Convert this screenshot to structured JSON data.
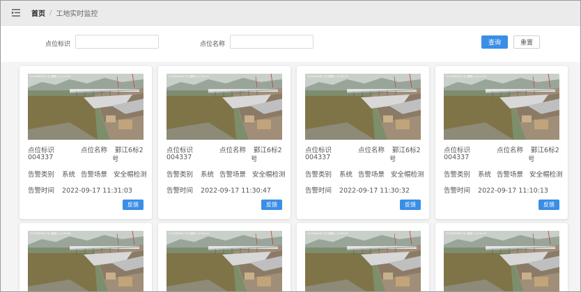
{
  "header": {
    "breadcrumb_home": "首页",
    "breadcrumb_sep": "/",
    "breadcrumb_current": "工地实时监控"
  },
  "search": {
    "code_label": "点位标识",
    "code_value": "",
    "name_label": "点位名称",
    "name_value": "",
    "query_label": "查询",
    "reset_label": "重置"
  },
  "labels": {
    "code": "点位标识",
    "name": "点位名称",
    "alarm_type": "告警类别",
    "alarm_scene": "告警场景",
    "alarm_time": "告警时间",
    "feedback": "反馈"
  },
  "cards": [
    {
      "code": "004337",
      "name_line1": "鄞江6标2",
      "name_line2": "号",
      "type": "系统",
      "scene": "安全帽检测",
      "time": "2022-09-17 11:31:03",
      "stamp": "2022年09月17日 星期六 11:31:03"
    },
    {
      "code": "004337",
      "name_line1": "鄞江6标2",
      "name_line2": "号",
      "type": "系统",
      "scene": "安全帽检测",
      "time": "2022-09-17 11:30:47",
      "stamp": "2022年09月17日 星期六 11:30:47"
    },
    {
      "code": "004337",
      "name_line1": "鄞江6标2",
      "name_line2": "号",
      "type": "系统",
      "scene": "安全帽检测",
      "time": "2022-09-17 11:30:32",
      "stamp": "2022年09月17日 星期六 11:30:32"
    },
    {
      "code": "004337",
      "name_line1": "鄞江6标2",
      "name_line2": "号",
      "type": "系统",
      "scene": "安全帽检测",
      "time": "2022-09-17 11:10:13",
      "stamp": "2022年09月17日 星期六 11:10:13"
    }
  ],
  "cards_row2": [
    {
      "stamp": "2022年09月17日 星期六 11:09:58"
    },
    {
      "stamp": "2022年09月17日 星期六 10:58:41"
    },
    {
      "stamp": "2022年09月17日 星期六 10:58:26"
    },
    {
      "stamp": "2022年09月17日 星期六 10:58:10"
    }
  ],
  "colors": {
    "primary": "#3a8ee6"
  },
  "icons": {
    "menu": "menu-fold-icon"
  }
}
